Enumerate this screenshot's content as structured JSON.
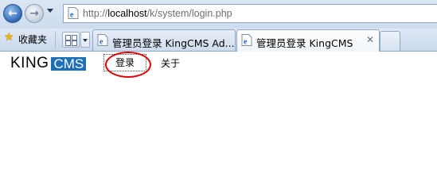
{
  "browser": {
    "url_prefix": "http://",
    "url_host": "localhost",
    "url_path": "/k/system/login.php",
    "favorites_label": "收藏夹",
    "tabs": [
      {
        "title": "管理员登录 KingCMS Ad...",
        "active": false
      },
      {
        "title": "管理员登录 KingCMS",
        "active": true,
        "close": "✕"
      }
    ]
  },
  "page": {
    "logo": {
      "king": "KING",
      "cms": "CMS"
    },
    "menu": {
      "login": "登录",
      "about": "关于"
    }
  },
  "colors": {
    "logo_cms_bg": "#1d6fb8",
    "annotation_circle": "#e30000"
  }
}
